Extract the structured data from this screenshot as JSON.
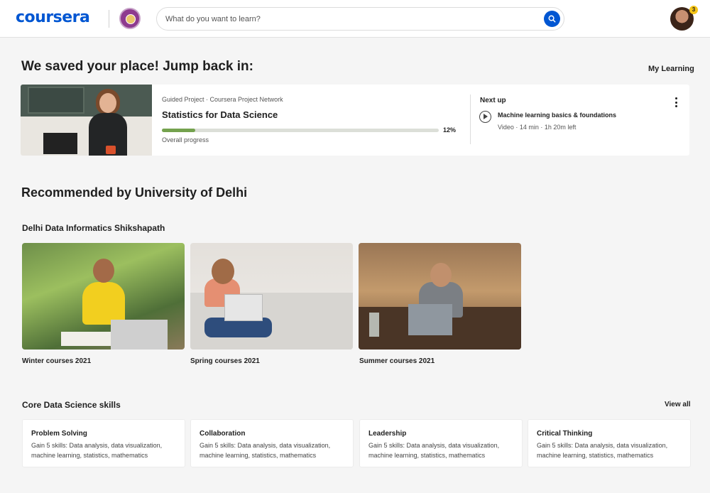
{
  "header": {
    "logo": "coursera",
    "search_placeholder": "What do you want to learn?",
    "notification_count": "3",
    "icons": [
      "search-icon",
      "avatar",
      "university-seal-logo"
    ]
  },
  "resume": {
    "heading": "We saved your place! Jump back in:",
    "my_learning": "My Learning",
    "meta": "Guided Project · Coursera Project Network",
    "title": "Statistics for Data Science",
    "progress_value": 0.12,
    "progress_text": "12%",
    "progress_label": "Overall progress",
    "next_up_label": "Next up",
    "next_title": "Machine learning basics & foundations",
    "next_meta": "Video · 14 min · 1h 20m left"
  },
  "recommended": {
    "heading": "Recommended by University of Delhi",
    "subheading": "Delhi Data Informatics Shikshapath",
    "tiles": [
      {
        "label": "Winter courses 2021"
      },
      {
        "label": "Spring courses 2021"
      },
      {
        "label": "Summer courses 2021"
      }
    ]
  },
  "core": {
    "heading": "Core Data Science skills",
    "view_all": "View all",
    "skills": [
      {
        "title": "Problem Solving",
        "desc": "Gain 5 skills: Data analysis, data visualization, machine learning, statistics, mathematics"
      },
      {
        "title": "Collaboration",
        "desc": "Gain 5 skills: Data analysis, data visualization, machine learning, statistics, mathematics"
      },
      {
        "title": "Leadership",
        "desc": "Gain 5 skills: Data analysis, data visualization, machine learning, statistics, mathematics"
      },
      {
        "title": "Critical Thinking",
        "desc": "Gain 5 skills: Data analysis, data visualization, machine learning, statistics, mathematics"
      }
    ]
  },
  "colors": {
    "brand": "#0056d2",
    "progress": "#74a24e",
    "badge": "#f5c518",
    "background": "#f5f5f5"
  }
}
